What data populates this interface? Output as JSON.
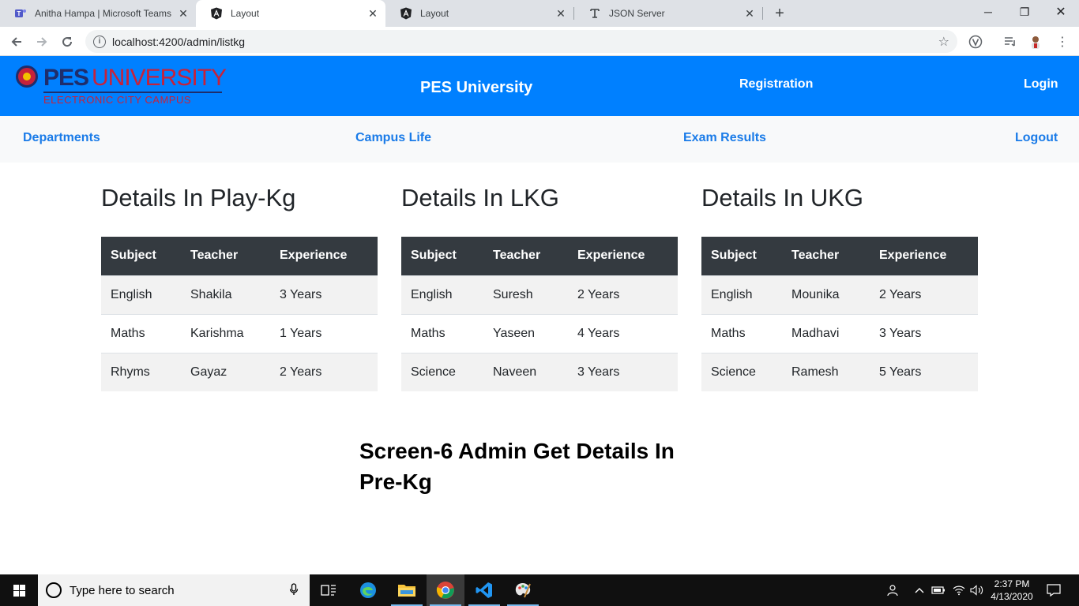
{
  "browser": {
    "tabs": [
      {
        "title": "Anitha Hampa | Microsoft Teams",
        "icon": "teams-icon",
        "active": false
      },
      {
        "title": "Layout",
        "icon": "angular-icon",
        "active": true
      },
      {
        "title": "Layout",
        "icon": "angular-icon",
        "active": false
      },
      {
        "title": "JSON Server",
        "icon": "json-server-icon",
        "active": false
      }
    ],
    "url": "localhost:4200/admin/listkg"
  },
  "header": {
    "logo": {
      "pes": "PES",
      "university": "UNIVERSITY",
      "campus": "ELECTRONIC CITY CAMPUS"
    },
    "brand": "PES University",
    "registration": "Registration",
    "login": "Login"
  },
  "subnav": {
    "departments": "Departments",
    "campus_life": "Campus Life",
    "exam_results": "Exam Results",
    "logout": "Logout"
  },
  "columns": {
    "subject": "Subject",
    "teacher": "Teacher",
    "experience": "Experience"
  },
  "panels": [
    {
      "title": "Details In Play-Kg",
      "rows": [
        {
          "subject": "English",
          "teacher": "Shakila",
          "experience": "3 Years"
        },
        {
          "subject": "Maths",
          "teacher": "Karishma",
          "experience": "1 Years"
        },
        {
          "subject": "Rhyms",
          "teacher": "Gayaz",
          "experience": "2 Years"
        }
      ]
    },
    {
      "title": "Details In LKG",
      "rows": [
        {
          "subject": "English",
          "teacher": "Suresh",
          "experience": "2 Years"
        },
        {
          "subject": "Maths",
          "teacher": "Yaseen",
          "experience": "4 Years"
        },
        {
          "subject": "Science",
          "teacher": "Naveen",
          "experience": "3 Years"
        }
      ]
    },
    {
      "title": "Details In UKG",
      "rows": [
        {
          "subject": "English",
          "teacher": "Mounika",
          "experience": "2 Years"
        },
        {
          "subject": "Maths",
          "teacher": "Madhavi",
          "experience": "3 Years"
        },
        {
          "subject": "Science",
          "teacher": "Ramesh",
          "experience": "5 Years"
        }
      ]
    }
  ],
  "caption": "Screen-6 Admin Get Details In Pre-Kg",
  "taskbar": {
    "search_placeholder": "Type here to search",
    "time": "2:37 PM",
    "date": "4/13/2020"
  },
  "colors": {
    "header_bg": "#0080ff",
    "link": "#1a7be8",
    "table_head": "#343a40"
  }
}
